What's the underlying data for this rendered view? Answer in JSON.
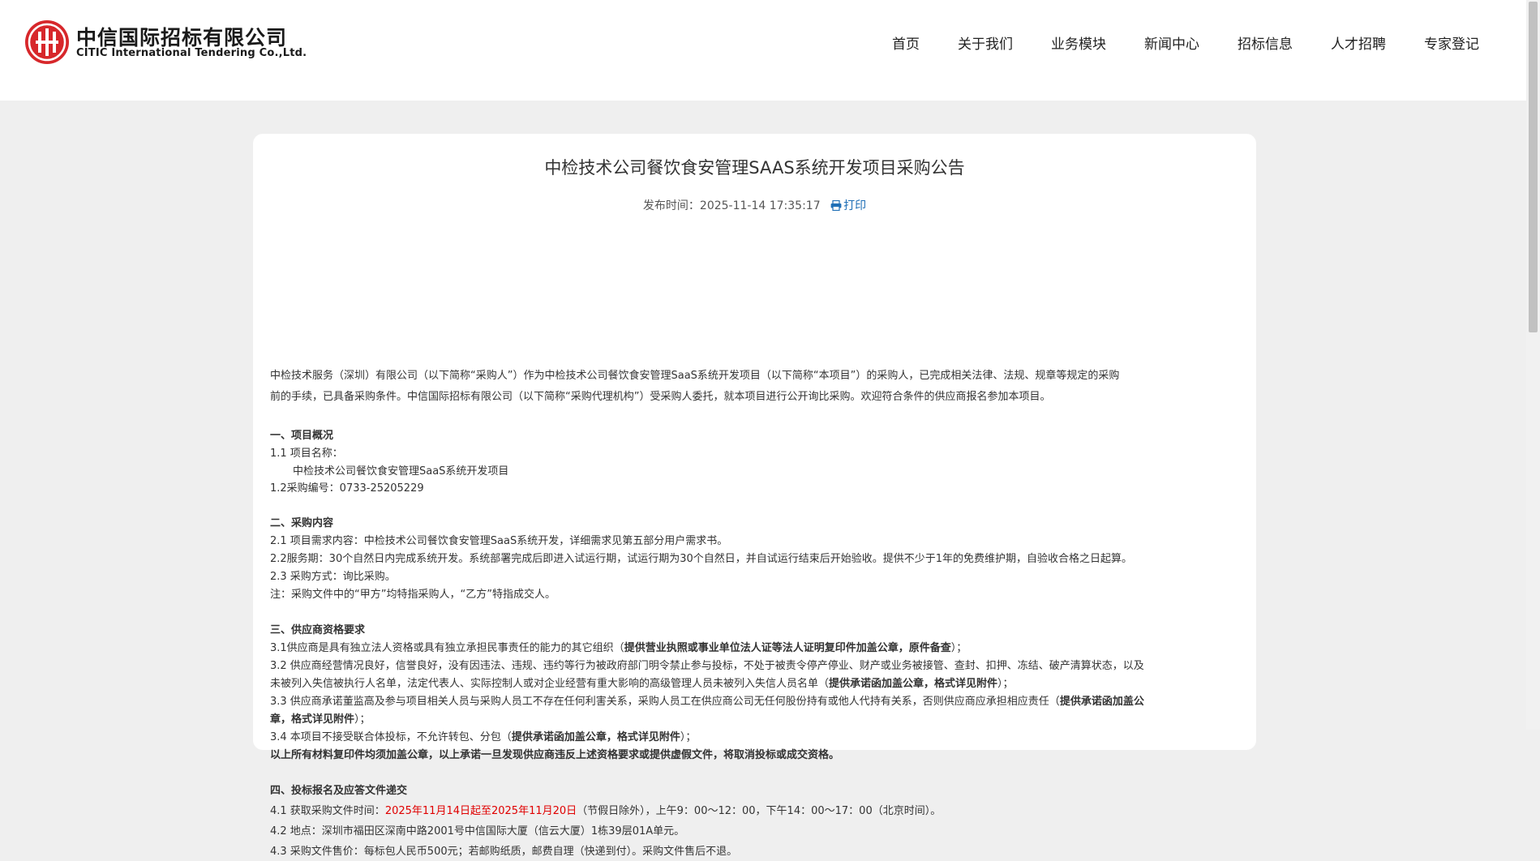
{
  "header": {
    "logo_cn": "中信国际招标有限公司",
    "logo_en": "CITIC International Tendering Co.,Ltd.",
    "nav": [
      "首页",
      "关于我们",
      "业务模块",
      "新闻中心",
      "招标信息",
      "人才招聘",
      "专家登记"
    ]
  },
  "article": {
    "title": "中检技术公司餐饮食安管理SAAS系统开发项目采购公告",
    "publish_label": "发布时间：",
    "publish_time": "2025-11-14 17:35:17",
    "print_label": "打印",
    "intro_1": " 中检技术服务（深圳）有限公司（以下简称“采购人”）作为中检技术公司餐饮食安管理SaaS系统开发项目（以下简称“本项目”）的采购人，已完成相关法律、法规、规章等规定的采购",
    "intro_2": "前的手续，已具备采购条件。中信国际招标有限公司（以下简称“采购代理机构”）受采购人委托，就本项目进行公开询比采购。欢迎符合条件的供应商报名参加本项目。",
    "s1_title": "一、项目概况",
    "s1_l1": "1.1 项目名称：",
    "s1_l2": "中检技术公司餐饮食安管理SaaS系统开发项目",
    "s1_l3": "1.2采购编号：0733-25205229",
    "s2_title": "二、采购内容",
    "s2_l1": "2.1 项目需求内容：中检技术公司餐饮食安管理SaaS系统开发，详细需求见第五部分用户需求书。",
    "s2_l2": "2.2服务期：30个自然日内完成系统开发。系统部署完成后即进入试运行期，试运行期为30个自然日，并自试运行结束后开始验收。提供不少于1年的免费维护期，自验收合格之日起算。",
    "s2_l3": "2.3 采购方式：询比采购。",
    "s2_l4": "注：采购文件中的“甲方”均特指采购人，“乙方”特指成交人。",
    "s3_title": "三、供应商资格要求",
    "s3_1_a": "3.1供应商是具有独立法人资格或具有独立承担民事责任的能力的其它组织（",
    "s3_1_b": "提供营业执照或事业单位法人证等法人证明复印件加盖公章，原件备查",
    "s3_1_c": "）；",
    "s3_2_line1": "3.2 供应商经营情况良好，信誉良好，没有因违法、违规、违约等行为被政府部门明令禁止参与投标，不处于被责令停产停业、财产或业务被接管、查封、扣押、冻结、破产清算状态，以及",
    "s3_2_a": "未被列入失信被执行人名单，法定代表人、实际控制人或对企业经营有重大影响的高级管理人员未被列入失信人员名单（",
    "s3_2_b": "提供承诺函加盖公章，格式详见附件",
    "s3_2_c": "）；",
    "s3_3_a": "3.3 供应商承诺董监高及参与项目相关人员与采购人员工不存在任何利害关系，采购人员工在供应商公司无任何股份持有或他人代持有关系，否则供应商应承担相应责任（",
    "s3_3_b": "提供承诺函加盖公",
    "s3_3_c": "章，格式详见附件",
    "s3_3_d": "）；",
    "s3_4_a": "3.4 本项目不接受联合体投标，不允许转包、分包（",
    "s3_4_b": "提供承诺函加盖公章，格式详见附件",
    "s3_4_c": "）；",
    "s3_note": "以上所有材料复印件均须加盖公章，以上承诺一旦发现供应商违反上述资格要求或提供虚假文件，将取消投标或成交资格。",
    "s4_title": "四、投标报名及应答文件递交",
    "s4_1_a": "4.1 获取采购文件时间：",
    "s4_1_b": "2025年11月14日起至2025年11月20日",
    "s4_1_c": "（节假日除外），上午9：00～12：00，下午14：00～17：00（北京时间）。",
    "s4_2": "4.2 地点：深圳市福田区深南中路2001号中信国际大厦（信云大厦）1栋39层01A单元。",
    "s4_3": "4.3 采购文件售价：每标包人民币500元；若邮购纸质，邮费自理（快递到付）。采购文件售后不退。"
  },
  "colors": {
    "accent_red": "#e00000",
    "logo_red": "#d7272b",
    "print_blue": "#1f6fb6"
  }
}
